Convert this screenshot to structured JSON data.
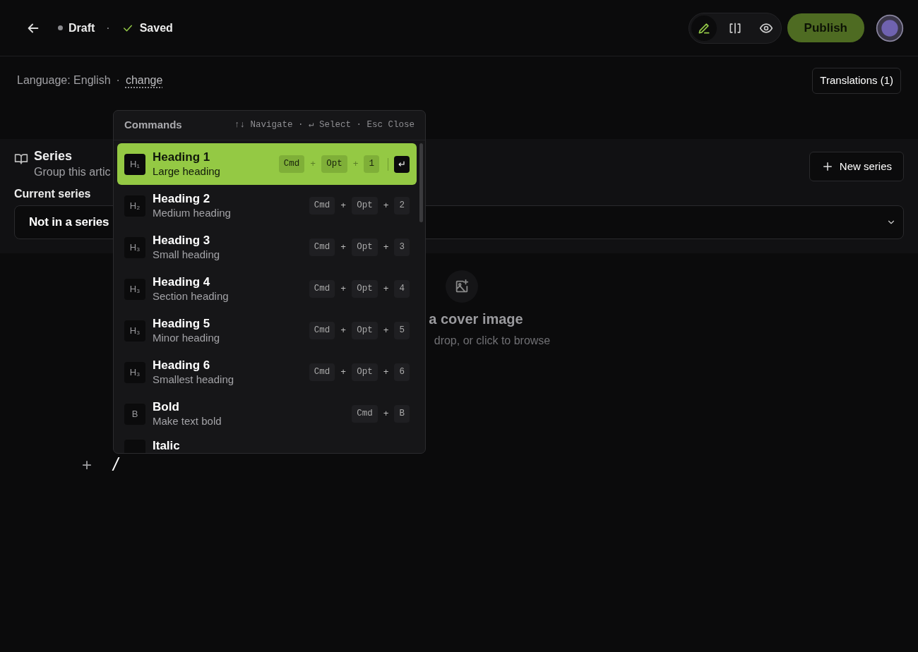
{
  "header": {
    "status": "Draft",
    "separator": "·",
    "save_state": "Saved",
    "modes": [
      {
        "kind": "edit",
        "selected": true
      },
      {
        "kind": "split",
        "selected": false
      },
      {
        "kind": "preview",
        "selected": false
      }
    ],
    "publish": "Publish"
  },
  "language": {
    "label": "Language: English",
    "separator": "·",
    "link": "change"
  },
  "translations": "Translations (1)",
  "series": {
    "title": "Series",
    "subtitle": "Group this artic",
    "new_button": "New series",
    "current_label": "Current series",
    "current_value": "Not in a series"
  },
  "cover": {
    "title": "a cover image",
    "hint": "drop, or click to browse"
  },
  "editor": {
    "add": "+",
    "text": "/"
  },
  "commands": {
    "title": "Commands",
    "hint": "↑↓ Navigate · ↵ Select · Esc Close",
    "items": [
      {
        "icon": "H₁",
        "title": "Heading 1",
        "subtitle": "Large heading",
        "shortcut": [
          "Cmd",
          "+",
          "Opt",
          "+",
          "1"
        ],
        "enter": "↵",
        "selected": true
      },
      {
        "icon": "H₂",
        "title": "Heading 2",
        "subtitle": "Medium heading",
        "shortcut": [
          "Cmd",
          "+",
          "Opt",
          "+",
          "2"
        ],
        "selected": false
      },
      {
        "icon": "H₃",
        "title": "Heading 3",
        "subtitle": "Small heading",
        "shortcut": [
          "Cmd",
          "+",
          "Opt",
          "+",
          "3"
        ],
        "selected": false
      },
      {
        "icon": "H₃",
        "title": "Heading 4",
        "subtitle": "Section heading",
        "shortcut": [
          "Cmd",
          "+",
          "Opt",
          "+",
          "4"
        ],
        "selected": false
      },
      {
        "icon": "H₃",
        "title": "Heading 5",
        "subtitle": "Minor heading",
        "shortcut": [
          "Cmd",
          "+",
          "Opt",
          "+",
          "5"
        ],
        "selected": false
      },
      {
        "icon": "H₃",
        "title": "Heading 6",
        "subtitle": "Smallest heading",
        "shortcut": [
          "Cmd",
          "+",
          "Opt",
          "+",
          "6"
        ],
        "selected": false
      },
      {
        "icon": "B",
        "title": "Bold",
        "subtitle": "Make text bold",
        "shortcut": [
          "Cmd",
          "+",
          "B"
        ],
        "selected": false
      },
      {
        "title": "Italic",
        "selected": false
      }
    ]
  }
}
